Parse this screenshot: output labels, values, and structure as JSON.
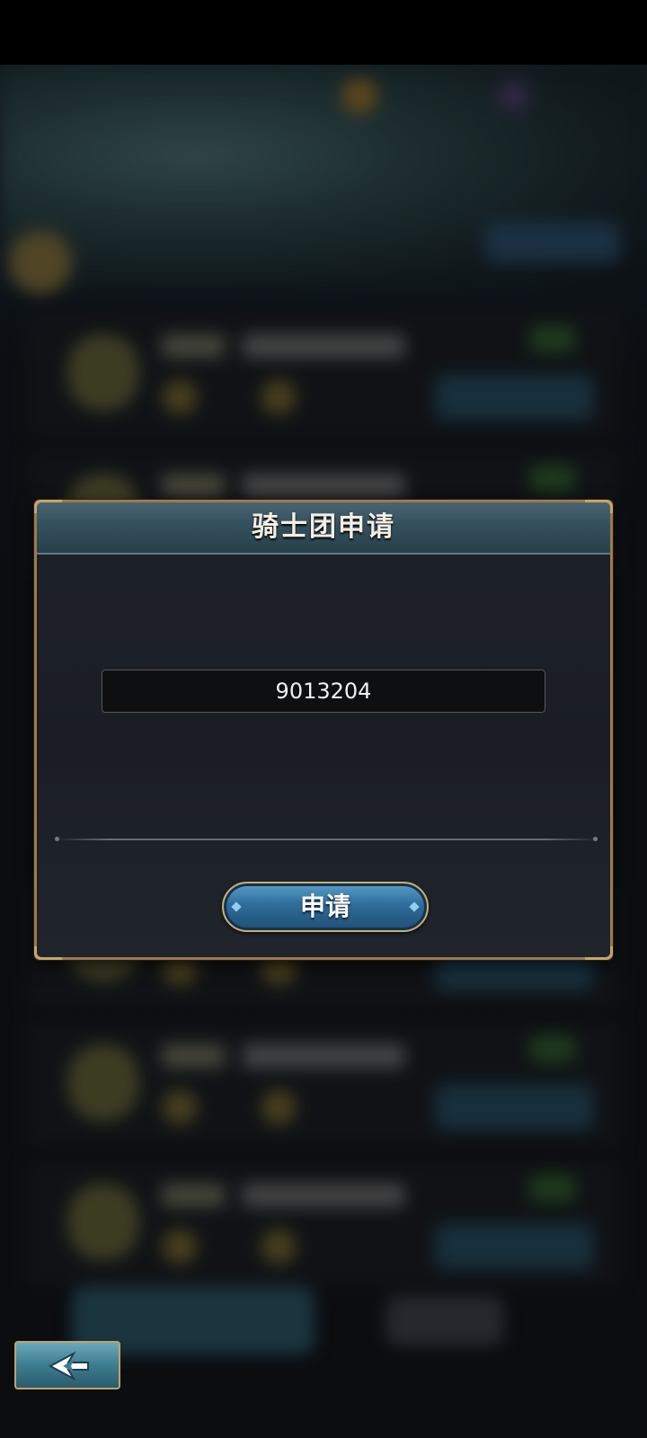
{
  "dialog": {
    "title": "骑士团申请",
    "id_value": "9013204",
    "apply_label": "申请"
  },
  "icons": {
    "back": "back-arrow-icon"
  }
}
